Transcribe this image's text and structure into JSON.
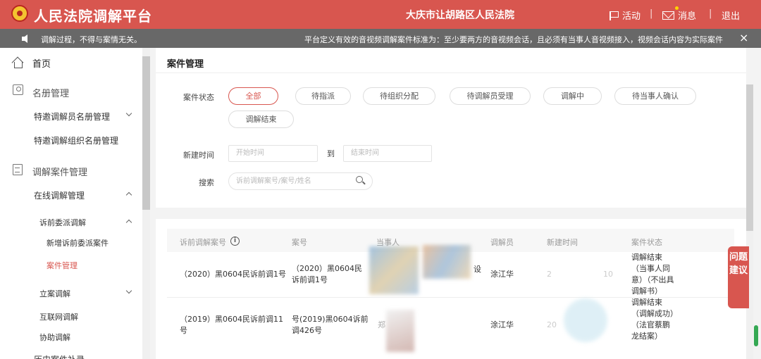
{
  "header": {
    "brand": "人民法院调解平台",
    "court": "大庆市让胡路区人民法院",
    "activity": "活动",
    "messages": "消息",
    "logout": "退出",
    "separator": "|"
  },
  "notice": {
    "left": "调解过程，不得与案情无关。",
    "right": "平台定义有效的音视频调解案件标准为：至少要两方的音视频会话，且必须有当事人音视频接入，视频会话内容为实际案件",
    "close": "×"
  },
  "sidebar": {
    "home": "首页",
    "roster": "名册管理",
    "mediator_roster": "特邀调解员名册管理",
    "org_roster": "特邀调解组织名册管理",
    "case_mgmt": "调解案件管理",
    "online": "在线调解管理",
    "pre_litigation": "诉前委派调解",
    "new_case": "新增诉前委派案件",
    "case_page": "案件管理",
    "filing": "立案调解",
    "internet": "互联网调解",
    "assist": "协助调解",
    "history": "历史案件补录"
  },
  "main": {
    "title": "案件管理",
    "status_label": "案件状态",
    "status_options": [
      "全部",
      "待指派",
      "待组织分配",
      "待调解员受理",
      "调解中",
      "待当事人确认",
      "调解结束"
    ],
    "time_label": "新建时间",
    "start_placeholder": "开始时间",
    "to": "到",
    "end_placeholder": "结束时间",
    "search_label": "搜索",
    "search_placeholder": "诉前调解案号/案号/姓名"
  },
  "table": {
    "headers": [
      "诉前调解案号",
      "案号",
      "当事人",
      "调解员",
      "新建时间",
      "案件状态"
    ],
    "rows": [
      {
        "pre_no": "（2020）黑0604民诉前调1号",
        "case_no": "（2020）黑0604民诉前调1号",
        "party": "",
        "party_tail": "设",
        "mediator": "涂江华",
        "created_a": "2",
        "created_b": "10",
        "status": "调解结束（当事人同意）（不出具调解书）"
      },
      {
        "pre_no": "（2019）黑0604民诉前调11号",
        "case_no": "号(2019)黑0604诉前调426号",
        "party": "郑",
        "mediator": "涂江华",
        "created_a": "20",
        "status": "调解结束（调解成功）（法官蔡鹏龙结案）"
      }
    ]
  },
  "feedback": "问题建议",
  "icons": [
    "emblem-icon",
    "flag-icon",
    "mail-icon",
    "speaker-icon",
    "close-icon",
    "home-icon",
    "user-icon",
    "document-icon",
    "search-icon",
    "info-icon",
    "chevron-down-icon",
    "chevron-up-icon"
  ],
  "colors": {
    "primary": "#d8564f",
    "notice_bg": "#686868"
  }
}
